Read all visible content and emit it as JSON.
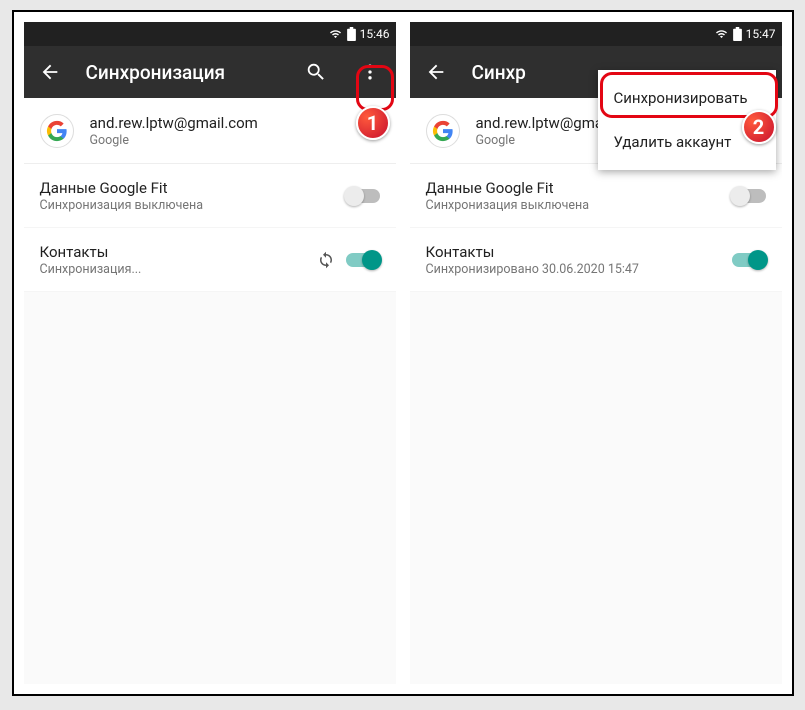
{
  "left": {
    "statusbar": {
      "time": "15:46"
    },
    "appbar": {
      "title": "Синхронизация"
    },
    "account": {
      "email": "and.rew.lptw@gmail.com",
      "provider": "Google"
    },
    "items": [
      {
        "title": "Данные Google Fit",
        "sub": "Синхронизация выключена",
        "on": false,
        "syncing": false
      },
      {
        "title": "Контакты",
        "sub": "Синхронизация...",
        "on": true,
        "syncing": true
      }
    ],
    "callout_badge": "1"
  },
  "right": {
    "statusbar": {
      "time": "15:47"
    },
    "appbar": {
      "title": "Синхр"
    },
    "account": {
      "email": "and.rew.lptw@gmail.com",
      "provider": "Google"
    },
    "items": [
      {
        "title": "Данные Google Fit",
        "sub": "Синхронизация выключена",
        "on": false,
        "syncing": false
      },
      {
        "title": "Контакты",
        "sub": "Синхронизировано 30.06.2020 15:47",
        "on": true,
        "syncing": false
      }
    ],
    "menu": {
      "sync": "Синхронизировать",
      "delete": "Удалить аккаунт"
    },
    "callout_badge": "2"
  }
}
